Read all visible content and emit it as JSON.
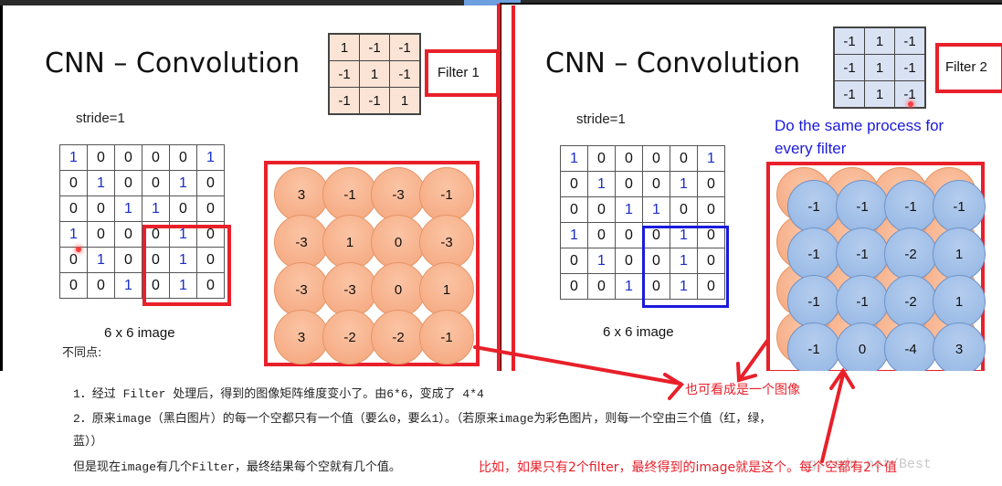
{
  "left_slide": {
    "title": "CNN – Convolution",
    "stride_label": "stride=1",
    "filter": [
      [
        "1",
        "-1",
        "-1"
      ],
      [
        "-1",
        "1",
        "-1"
      ],
      [
        "-1",
        "-1",
        "1"
      ]
    ],
    "filter_label": "Filter 1",
    "image": [
      [
        "1",
        "0",
        "0",
        "0",
        "0",
        "1"
      ],
      [
        "0",
        "1",
        "0",
        "0",
        "1",
        "0"
      ],
      [
        "0",
        "0",
        "1",
        "1",
        "0",
        "0"
      ],
      [
        "1",
        "0",
        "0",
        "0",
        "1",
        "0"
      ],
      [
        "0",
        "1",
        "0",
        "0",
        "1",
        "0"
      ],
      [
        "0",
        "0",
        "1",
        "0",
        "1",
        "0"
      ]
    ],
    "image_caption": "6 x 6 image",
    "feature_map": [
      [
        "3",
        "-1",
        "-3",
        "-1"
      ],
      [
        "-3",
        "1",
        "0",
        "-3"
      ],
      [
        "-3",
        "-3",
        "0",
        "1"
      ],
      [
        "3",
        "-2",
        "-2",
        "-1"
      ]
    ],
    "highlight_color": "#e8202a"
  },
  "right_slide": {
    "title": "CNN – Convolution",
    "stride_label": "stride=1",
    "filter": [
      [
        "-1",
        "1",
        "-1"
      ],
      [
        "-1",
        "1",
        "-1"
      ],
      [
        "-1",
        "1",
        "-1"
      ]
    ],
    "filter_label": "Filter 2",
    "note": "Do the same process for every filter",
    "note_line1": "Do the same process for",
    "note_line2": "every filter",
    "image": [
      [
        "1",
        "0",
        "0",
        "0",
        "0",
        "1"
      ],
      [
        "0",
        "1",
        "0",
        "0",
        "1",
        "0"
      ],
      [
        "0",
        "0",
        "1",
        "1",
        "0",
        "0"
      ],
      [
        "1",
        "0",
        "0",
        "0",
        "1",
        "0"
      ],
      [
        "0",
        "1",
        "0",
        "0",
        "1",
        "0"
      ],
      [
        "0",
        "0",
        "1",
        "0",
        "1",
        "0"
      ]
    ],
    "image_caption": "6 x 6 image",
    "feature_map": [
      [
        "-1",
        "-1",
        "-1",
        "-1"
      ],
      [
        "-1",
        "-1",
        "-2",
        "1"
      ],
      [
        "-1",
        "-1",
        "-2",
        "1"
      ],
      [
        "-1",
        "0",
        "-4",
        "3"
      ]
    ],
    "highlight_color": "#1a1adc"
  },
  "notes": {
    "heading": "不同点:",
    "line1_prefix": "1．经过 Filter 处理后，得到的图像矩阵维度变小了。由6*6，变成了 4*4",
    "line2": "2．原来image（黑白图片）的每一个空都只有一个值（要么0，要么1）。（若原来image为彩色图片，则每一个空由三个值（红，绿，",
    "line3": "蓝））",
    "line4": "但是现在image有几个Filter，最终结果每个空就有几个值。"
  },
  "annotations": {
    "image_note": "也可看成是一个图像",
    "example_note": "比如，如果只有2个filter，最终得到的image就是这个。每个空都有2个值",
    "color": "#e8202a"
  },
  "watermark": "g.csdn.net/Best"
}
